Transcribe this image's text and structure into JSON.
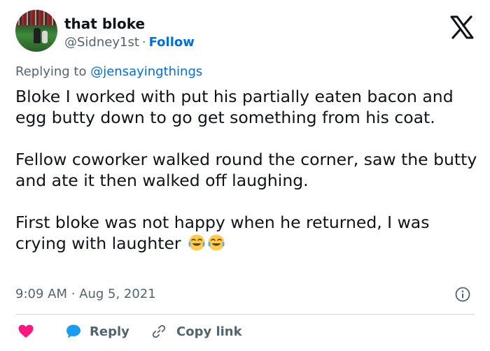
{
  "author": {
    "display_name": "that bloke",
    "handle": "@Sidney1st",
    "separator": "·",
    "follow_label": "Follow"
  },
  "reply_context": {
    "prefix": "Replying to ",
    "mention": "@jensayingthings"
  },
  "tweet": {
    "paragraphs": [
      "Bloke I worked with put his partially eaten bacon and egg butty down to go get something from his coat.",
      "Fellow coworker walked round the corner, saw the butty and ate it then walked off laughing.",
      "First bloke was not happy when he returned, I was crying with laughter "
    ],
    "emoji": [
      "face-with-tears-of-joy",
      "face-with-tears-of-joy"
    ],
    "timestamp": "9:09 AM · Aug 5, 2021"
  },
  "actions": {
    "reply_label": "Reply",
    "copy_label": "Copy link"
  },
  "icons": {
    "brand": "x-logo-icon",
    "info": "info-icon",
    "like": "heart-icon",
    "reply": "speech-bubble-icon",
    "copy": "link-icon"
  },
  "colors": {
    "text": "#0f1419",
    "secondary": "#536471",
    "link": "#006fd6",
    "like": "#f91880",
    "reply_icon": "#1d9bf0",
    "divider": "#cfd9de"
  }
}
